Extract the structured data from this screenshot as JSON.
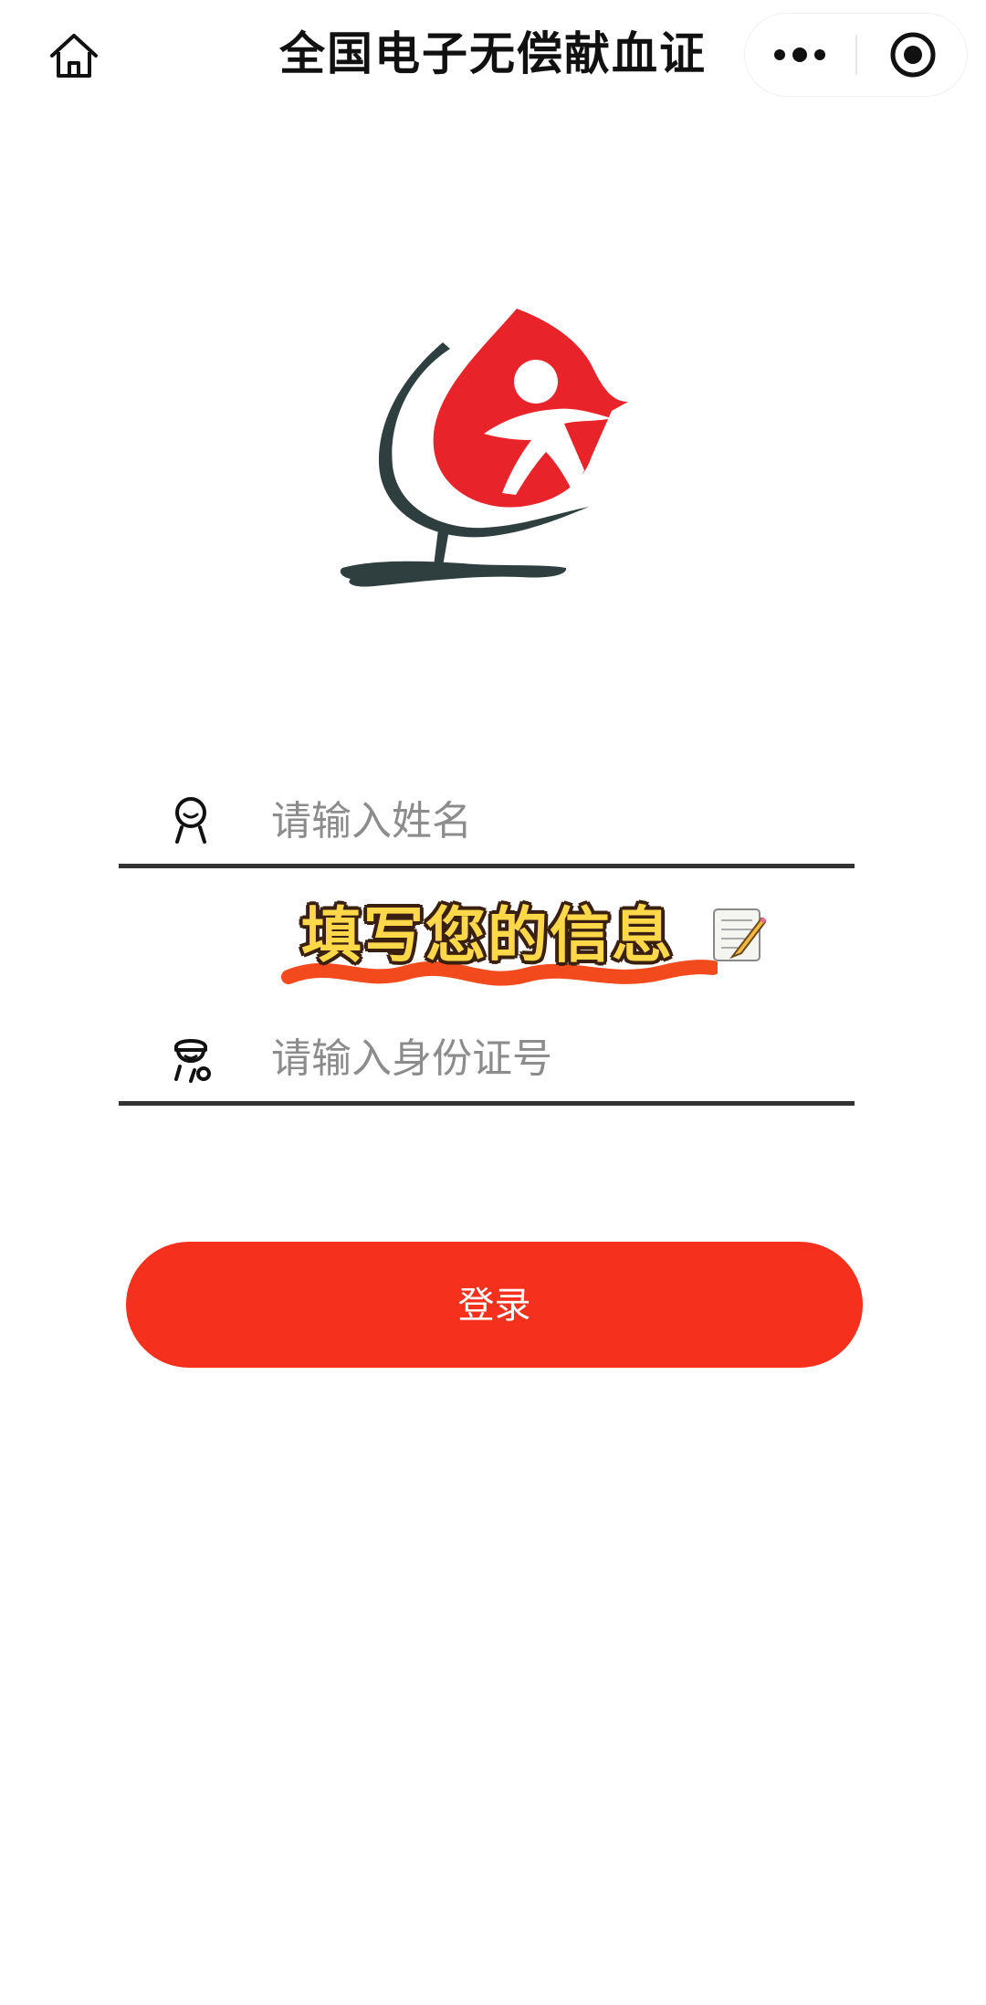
{
  "header": {
    "title": "全国电子无偿献血证",
    "home_icon": "home-icon",
    "more_icon": "more-dots-icon",
    "close_icon": "record-target-icon"
  },
  "form": {
    "name_placeholder": "请输入姓名",
    "name_value": "",
    "banner_text": "填写您的信息",
    "id_placeholder": "请输入身份证号",
    "id_value": "",
    "login_label": "登录"
  },
  "colors": {
    "accent": "#f5301d",
    "logo_red": "#e8242a",
    "logo_dark": "#2f3f3f",
    "underline": "#333333"
  }
}
